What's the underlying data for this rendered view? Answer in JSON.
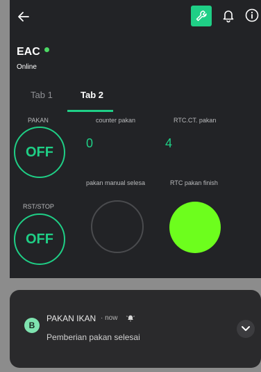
{
  "device": {
    "name": "EAC",
    "status": "Online"
  },
  "tabs": [
    {
      "label": "Tab 1"
    },
    {
      "label": "Tab 2"
    }
  ],
  "widgets": {
    "pakan": {
      "label": "PAKAN",
      "state": "OFF"
    },
    "counter_pakan": {
      "label": "counter pakan",
      "value": "0"
    },
    "rtc_ct_pakan": {
      "label": "RTC.CT. pakan",
      "value": "4"
    },
    "rst_stop": {
      "label": "RST/STOP",
      "state": "OFF"
    },
    "pakan_manual_selesai": {
      "label": "pakan manual selesa",
      "led_on": false
    },
    "rtc_pakan_finish": {
      "label": "RTC pakan finish",
      "led_on": true
    }
  },
  "notification": {
    "app_icon_letter": "B",
    "app": "PAKAN IKAN",
    "time": "· now",
    "message": "Pemberian pakan selesai"
  },
  "colors": {
    "accent": "#1fcf86",
    "led_on": "#6dfe1d",
    "status_online": "#4cd964",
    "background": "#222326"
  },
  "icons": {
    "back": "arrow-left-icon",
    "settings": "wrench-icon",
    "notifications": "bell-icon",
    "info": "info-icon",
    "notification_bell": "bell-ringing-icon",
    "expand": "chevron-down-icon"
  }
}
